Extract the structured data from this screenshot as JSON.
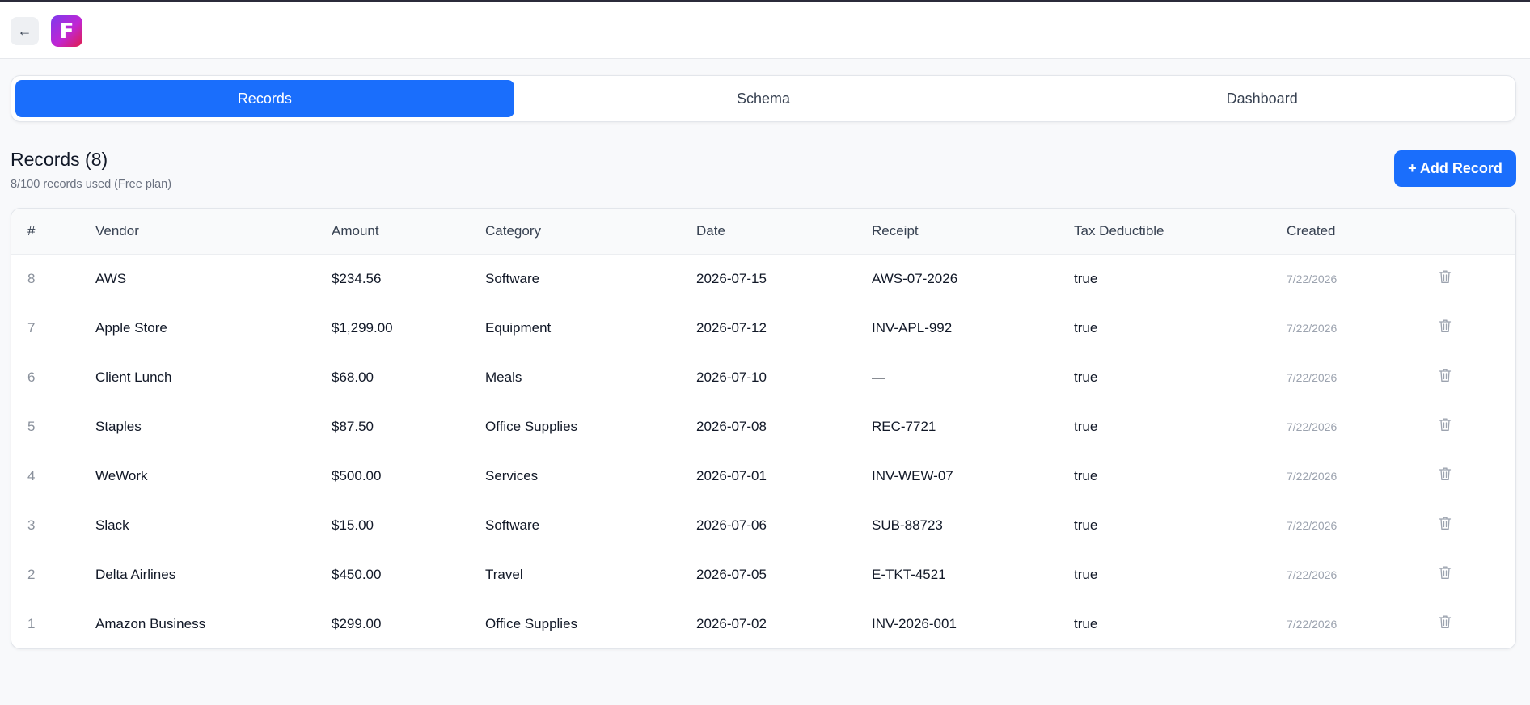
{
  "header": {
    "back_icon": "arrow-left-icon",
    "back_glyph": "←",
    "logo_letter": "F"
  },
  "tabs": [
    {
      "label": "Records",
      "active": true
    },
    {
      "label": "Schema",
      "active": false
    },
    {
      "label": "Dashboard",
      "active": false
    }
  ],
  "records": {
    "title": "Records (8)",
    "subtitle": "8/100 records used (Free plan)",
    "add_button_label": "+ Add Record"
  },
  "table": {
    "columns": [
      "#",
      "Vendor",
      "Amount",
      "Category",
      "Date",
      "Receipt",
      "Tax Deductible",
      "Created"
    ],
    "rows": [
      {
        "num": "8",
        "vendor": "AWS",
        "amount": "$234.56",
        "category": "Software",
        "date": "2026-07-15",
        "receipt": "AWS-07-2026",
        "tax": "true",
        "created": "7/22/2026"
      },
      {
        "num": "7",
        "vendor": "Apple Store",
        "amount": "$1,299.00",
        "category": "Equipment",
        "date": "2026-07-12",
        "receipt": "INV-APL-992",
        "tax": "true",
        "created": "7/22/2026"
      },
      {
        "num": "6",
        "vendor": "Client Lunch",
        "amount": "$68.00",
        "category": "Meals",
        "date": "2026-07-10",
        "receipt": "—",
        "tax": "true",
        "created": "7/22/2026"
      },
      {
        "num": "5",
        "vendor": "Staples",
        "amount": "$87.50",
        "category": "Office Supplies",
        "date": "2026-07-08",
        "receipt": "REC-7721",
        "tax": "true",
        "created": "7/22/2026"
      },
      {
        "num": "4",
        "vendor": "WeWork",
        "amount": "$500.00",
        "category": "Services",
        "date": "2026-07-01",
        "receipt": "INV-WEW-07",
        "tax": "true",
        "created": "7/22/2026"
      },
      {
        "num": "3",
        "vendor": "Slack",
        "amount": "$15.00",
        "category": "Software",
        "date": "2026-07-06",
        "receipt": "SUB-88723",
        "tax": "true",
        "created": "7/22/2026"
      },
      {
        "num": "2",
        "vendor": "Delta Airlines",
        "amount": "$450.00",
        "category": "Travel",
        "date": "2026-07-05",
        "receipt": "E-TKT-4521",
        "tax": "true",
        "created": "7/22/2026"
      },
      {
        "num": "1",
        "vendor": "Amazon Business",
        "amount": "$299.00",
        "category": "Office Supplies",
        "date": "2026-07-02",
        "receipt": "INV-2026-001",
        "tax": "true",
        "created": "7/22/2026"
      }
    ],
    "row_action_icon": "trash-icon"
  },
  "colors": {
    "accent": "#1a6efc",
    "logo_gradient_start": "#7c3aed",
    "logo_gradient_end": "#e11d48"
  }
}
